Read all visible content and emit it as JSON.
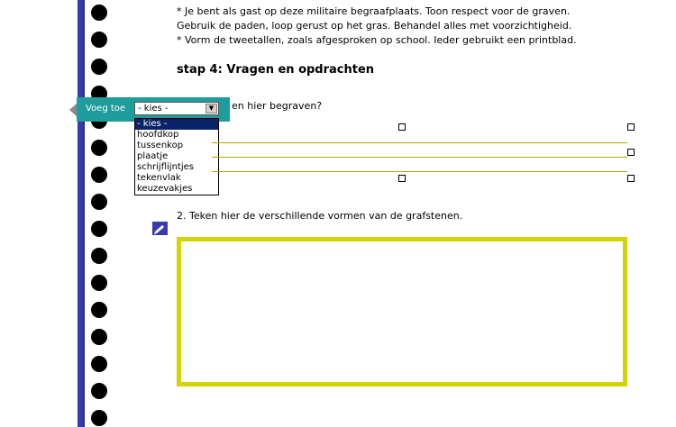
{
  "worksheet": {
    "intro_lines": [
      "* Je bent als gast op deze militaire begraafplaats. Toon respect voor de graven.",
      "Gebruik de paden, loop gerust op het gras. Behandel alles met voorzichtigheid.",
      "* Vorm de tweetallen, zoals afgesproken op school. Ieder gebruikt een printblad."
    ],
    "step_heading": "stap 4: Vragen en opdrachten",
    "question1_visible_tail": "en hier begraven?",
    "question2": "2. Teken hier de verschillende vormen van de grafstenen."
  },
  "insert_toolbar": {
    "label": "Voeg toe",
    "select_value": "- kies -",
    "options": [
      "- kies -",
      "hoofdkop",
      "tussenkop",
      "plaatje",
      "schrijflijntjes",
      "tekenvlak",
      "keuzevakjes"
    ],
    "highlighted_option": "- kies -"
  },
  "colors": {
    "toolbar": "#1f9c9c",
    "binder_edge": "#3a3aa8",
    "writing_lines": "#b4a400",
    "drawing_frame": "#d4d400",
    "selection": "#0a246a"
  },
  "icons": {
    "pen": "pen-icon",
    "dropdown_arrow": "chevron-down-icon"
  }
}
